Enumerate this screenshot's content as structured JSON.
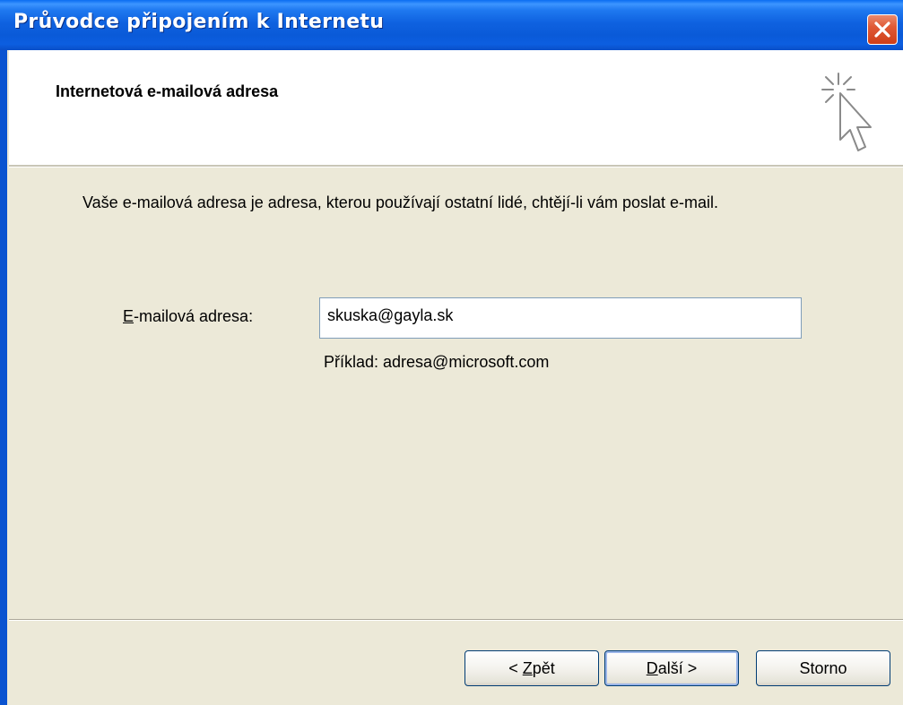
{
  "window": {
    "title": "Průvodce připojením k Internetu"
  },
  "header": {
    "title": "Internetová e-mailová adresa",
    "icon": "wizard-cursor-icon"
  },
  "body": {
    "description": "Vaše e-mailová adresa je adresa, kterou používají ostatní lidé, chtějí-li vám poslat e-mail.",
    "email_label_accel": "E",
    "email_label_rest": "-mailová adresa:",
    "email_value": "skuska@gayla.sk",
    "example": "Příklad: adresa@microsoft.com"
  },
  "buttons": {
    "back_pre": "< ",
    "back_accel": "Z",
    "back_rest": "pět",
    "next_accel": "D",
    "next_rest": "alší >",
    "cancel": "Storno"
  },
  "colors": {
    "titlebar": "#0a5ad8",
    "close": "#e05a36",
    "dialog_bg": "#ece9d8",
    "header_bg": "#ffffff"
  }
}
